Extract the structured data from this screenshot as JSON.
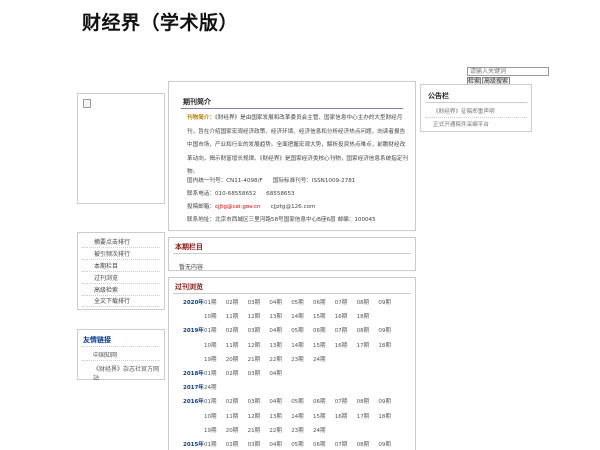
{
  "site": {
    "title": "财经界（学术版）"
  },
  "search": {
    "placeholder": "请输入关键词",
    "search_label": "检索",
    "advanced_label": "高级搜索"
  },
  "left_menu": {
    "items": [
      "摘要点击排行",
      "被引频次排行",
      "本期栏目",
      "过刊浏览",
      "高级检索",
      "全文下载排行"
    ]
  },
  "friend_links": {
    "title": "友情链接",
    "items": [
      "中国知网",
      "《财经界》杂志社官方网站"
    ]
  },
  "intro": {
    "title": "期刊简介",
    "lead": "刊物简介：",
    "body": "《财经界》是由国家发展和改革委员会主管、国家信息中心主办的大型财经月刊，旨在介绍国家宏观经济政策、经济环境、经济信息和分析经济热点问题，向读者报告中国市场，产业和行业的发展趋势。全面把握宏观大势，解析投资热点难点，前瞻财经改革动向，揭示财富增长规律。《财经界》是国家经济类核心刊物，国家经济信息系统指定刊物。",
    "cn_label": "国内统一刊号：CN11-4098/F",
    "issn_label": "国际标准刊号：ISSN1009-2781",
    "phone_label": "联系电话：010-68558652",
    "phone2": "68558653",
    "email_label": "投稿邮箱：",
    "email1": "cjjtg@cei.gov.cn",
    "email2": "cjjztg@126.com",
    "address": "联系地址：北京市西城区三里河路58号国家信息中心B座6层  邮编：100045"
  },
  "current_issue": {
    "title": "本期栏目",
    "empty_text": "暂无内容"
  },
  "past_issues": {
    "title": "过刊浏览",
    "years": [
      {
        "year": "2020年",
        "rows": [
          [
            "01期",
            "02期",
            "03期",
            "04期",
            "05期",
            "06期",
            "07期",
            "08期",
            "09期"
          ],
          [
            "10期",
            "11期",
            "12期",
            "13期",
            "14期",
            "15期",
            "16期",
            "18期"
          ]
        ]
      },
      {
        "year": "2019年",
        "rows": [
          [
            "01期",
            "02期",
            "03期",
            "04期",
            "05期",
            "06期",
            "07期",
            "08期",
            "09期"
          ],
          [
            "10期",
            "11期",
            "12期",
            "13期",
            "14期",
            "15期",
            "16期",
            "17期",
            "18期"
          ],
          [
            "19期",
            "20期",
            "21期",
            "22期",
            "23期",
            "24期"
          ]
        ]
      },
      {
        "year": "2018年",
        "rows": [
          [
            "01期",
            "02期",
            "03期",
            "04期"
          ]
        ]
      },
      {
        "year": "2017年",
        "rows": [
          [
            "24期"
          ]
        ]
      },
      {
        "year": "2016年",
        "rows": [
          [
            "01期",
            "02期",
            "03期",
            "04期",
            "05期",
            "06期",
            "07期",
            "08期",
            "09期"
          ],
          [
            "10期",
            "11期",
            "12期",
            "13期",
            "14期",
            "15期",
            "16期",
            "17期",
            "18期"
          ],
          [
            "19期",
            "20期",
            "21期",
            "22期",
            "23期",
            "24期"
          ]
        ]
      },
      {
        "year": "2015年",
        "rows": [
          [
            "01期",
            "02期",
            "03期",
            "04期",
            "05期",
            "06期",
            "07期",
            "08期",
            "09期"
          ]
        ]
      }
    ]
  },
  "notice": {
    "title": "公告栏",
    "items": [
      "《财经界》征稿郑重声明",
      "正式开通稿件采编平台"
    ]
  }
}
